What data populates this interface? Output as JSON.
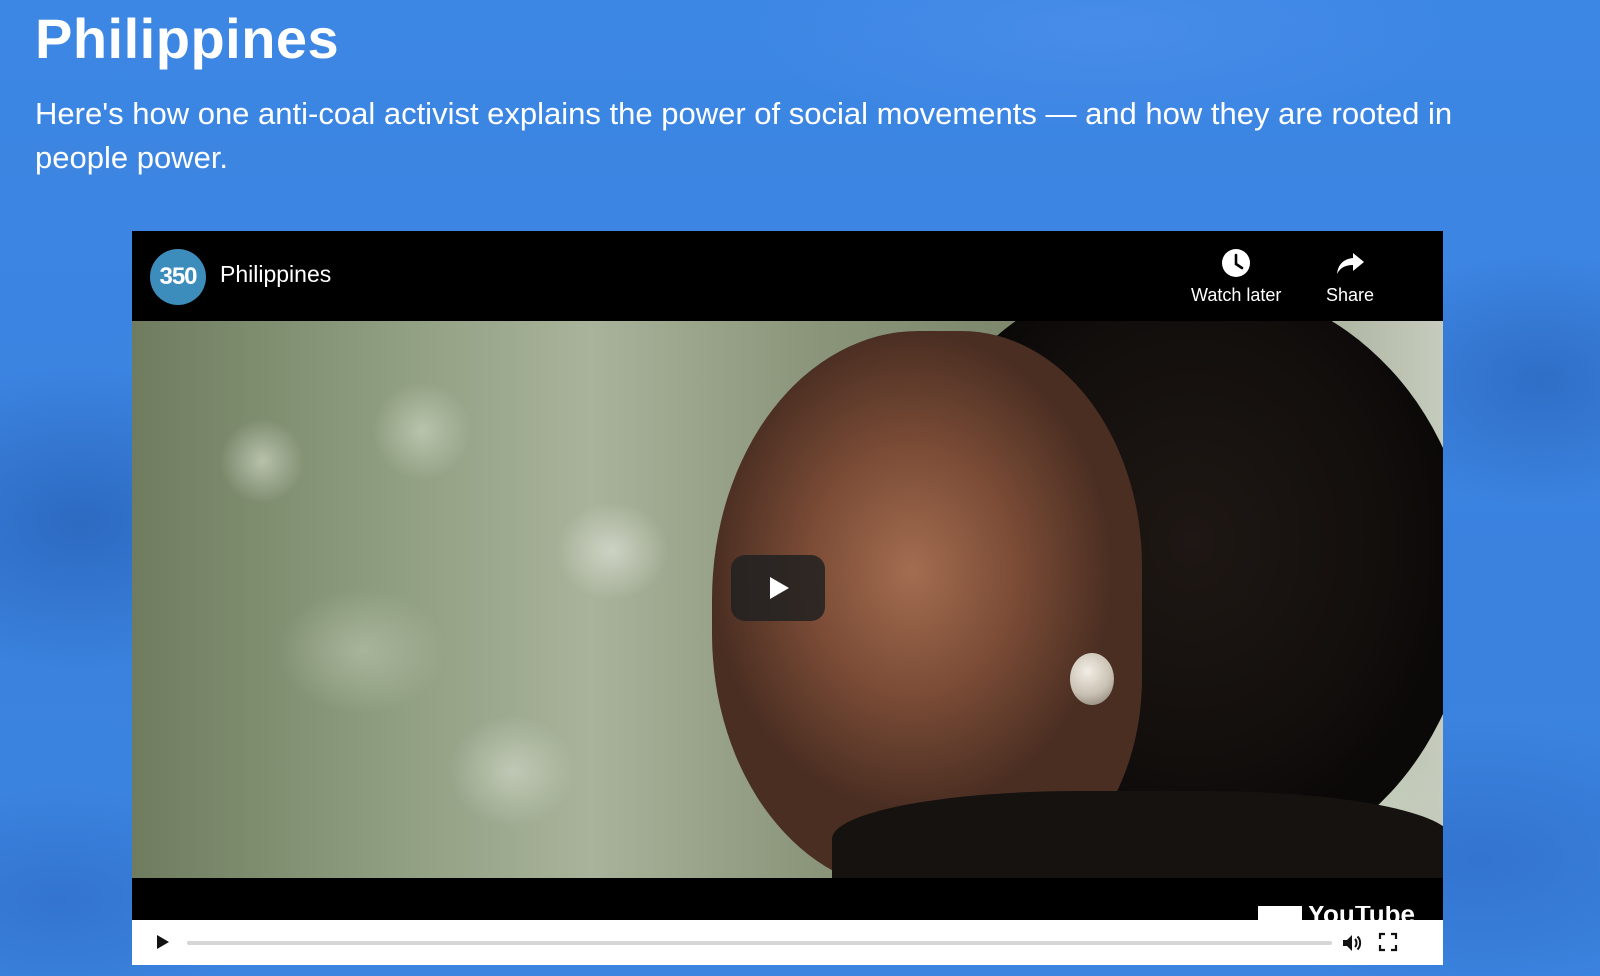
{
  "page": {
    "heading": "Philippines",
    "subheading": "Here's how one anti-coal activist explains the power of social movements — and how they are rooted in people power."
  },
  "video": {
    "channel_avatar_text": "350",
    "title": "Philippines",
    "watch_later_label": "Watch later",
    "share_label": "Share",
    "brand_text": "YouTube",
    "progress": 0,
    "colors": {
      "accent": "#3d86e2",
      "avatar": "#3c8dbc",
      "progress": "#c00000"
    },
    "icons": {
      "watch_later": "clock-icon",
      "share": "share-arrow-icon",
      "play_big": "play-icon",
      "play": "play-icon",
      "volume": "volume-icon",
      "fullscreen": "fullscreen-icon"
    }
  }
}
